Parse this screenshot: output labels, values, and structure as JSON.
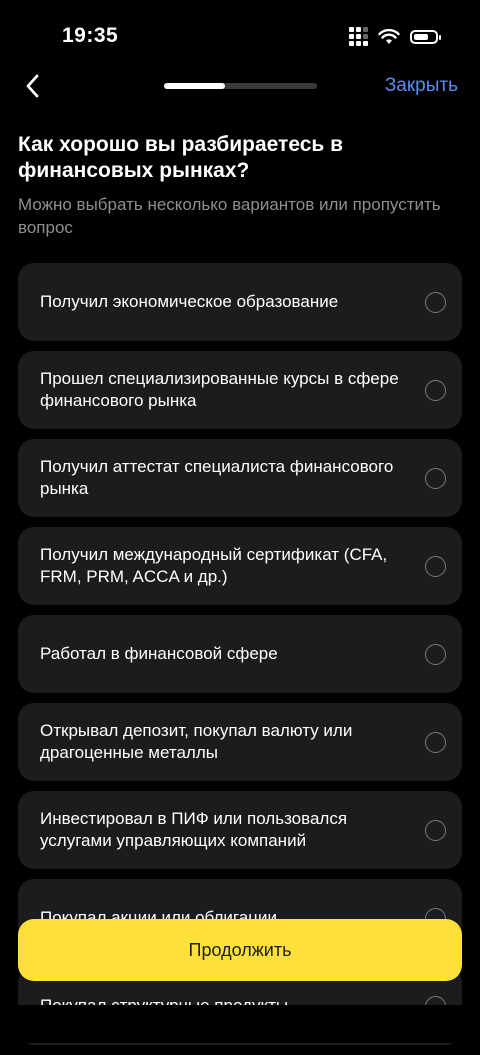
{
  "status": {
    "time": "19:35"
  },
  "nav": {
    "close_label": "Закрыть",
    "progress": 0.4
  },
  "question": {
    "title": "Как хорошо вы разбираетесь в финансовых рынках?",
    "hint": "Можно выбрать несколько вариантов или пропустить вопрос"
  },
  "options": [
    {
      "label": "Получил экономическое образование"
    },
    {
      "label": "Прошел специализированные курсы в сфере финансового рынка"
    },
    {
      "label": "Получил аттестат специалиста финансового рынка"
    },
    {
      "label": "Получил международный сертификат (CFA, FRM, PRM, ACCA и др.)"
    },
    {
      "label": "Работал в финансовой сфере"
    },
    {
      "label": "Открывал депозит, покупал валюту или драгоценные металлы"
    },
    {
      "label": "Инвестировал в ПИФ или пользовался услугами управляющих компаний"
    },
    {
      "label": "Покупал акции или облигации"
    },
    {
      "label": "Покупал структурные продукты,"
    }
  ],
  "continue_label": "Продолжить",
  "colors": {
    "accent": "#fde13a",
    "link": "#5b8def",
    "card": "#1c1c1e"
  }
}
